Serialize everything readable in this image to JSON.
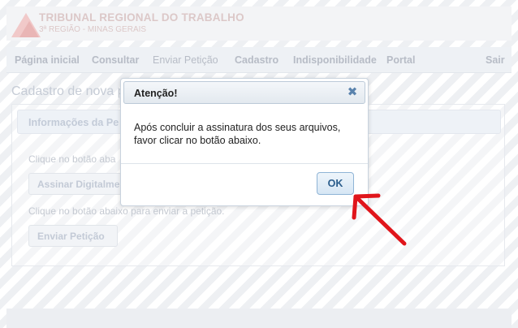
{
  "header": {
    "brand_title": "TRIBUNAL REGIONAL DO TRABALHO",
    "brand_subtitle": "3ª REGIÃO - MINAS GERAIS"
  },
  "nav": {
    "items": [
      {
        "label": "Página inicial"
      },
      {
        "label": "Consultar"
      },
      {
        "label": "Enviar Petição"
      },
      {
        "label": "Cadastro"
      },
      {
        "label": "Indisponibilidade"
      },
      {
        "label": "Portal"
      }
    ],
    "exit_label": "Sair"
  },
  "page": {
    "title": "Cadastro de nova p",
    "panel_header": "Informações da Pe",
    "instruction_sign": "Clique no botão aba",
    "sign_button": "Assinar Digitalme",
    "instruction_send": "Clique no botão abaixo para enviar a petição.",
    "send_button": "Enviar Petição"
  },
  "dialog": {
    "title": "Atenção!",
    "close_icon": "close-icon",
    "message_line1": "Após concluir a assinatura dos seus arquivos,",
    "message_line2": "favor clicar no botão abaixo.",
    "ok_label": "OK"
  },
  "annotation": {
    "arrow_color": "#e0151b"
  },
  "colors": {
    "dialog_title_bg": "#e3e9ef",
    "ok_button_text": "#2a5d8c",
    "close_icon": "#5a83ad"
  }
}
